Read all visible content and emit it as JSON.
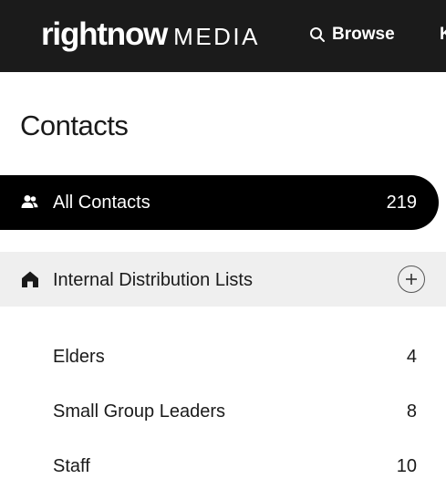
{
  "header": {
    "logo_main": "rightnow",
    "logo_media": "MEDIA",
    "nav_browse": "Browse",
    "nav_next_partial": "K"
  },
  "page": {
    "title": "Contacts"
  },
  "all_contacts": {
    "label": "All Contacts",
    "count": "219",
    "icon": "people-icon"
  },
  "distribution": {
    "label": "Internal Distribution Lists",
    "icon": "home-icon",
    "add_icon": "plus-circle-icon",
    "items": [
      {
        "label": "Elders",
        "count": "4"
      },
      {
        "label": "Small Group Leaders",
        "count": "8"
      },
      {
        "label": "Staff",
        "count": "10"
      }
    ]
  },
  "colors": {
    "topbar": "#1b1b1b",
    "active_item": "#000000",
    "section_bg": "#efefef",
    "text": "#1a1a1a"
  }
}
